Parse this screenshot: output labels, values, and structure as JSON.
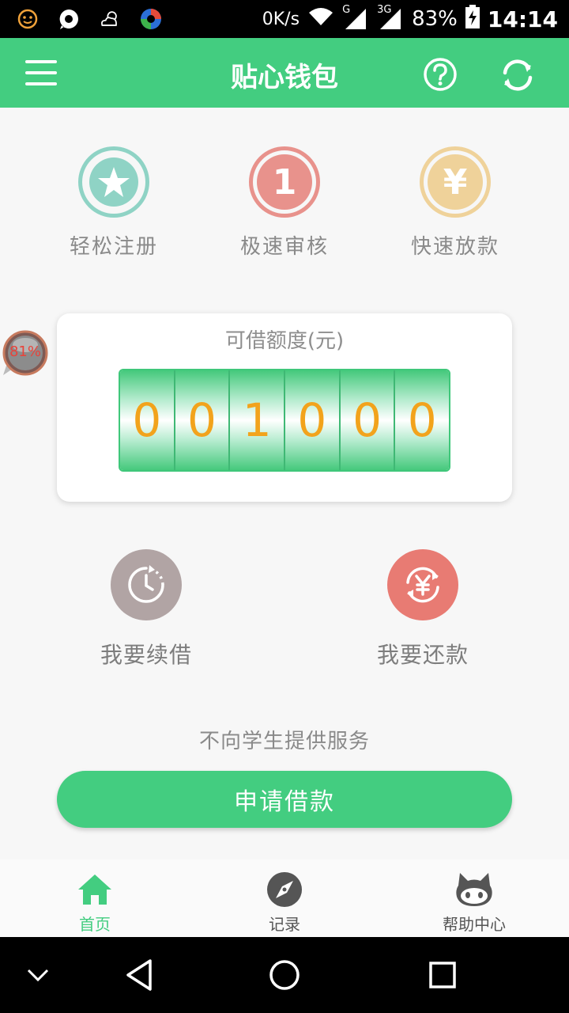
{
  "status_bar": {
    "net_speed": "0K/s",
    "battery": "83%",
    "time": "14:14",
    "network_g": "G",
    "network_3g": "3G"
  },
  "app_bar": {
    "title": "贴心钱包"
  },
  "features": [
    {
      "label": "轻松注册",
      "icon": "star-icon",
      "color": "#8fd3c5"
    },
    {
      "label": "极速审核",
      "icon": "one-icon",
      "color": "#e8928c",
      "glyph": "1"
    },
    {
      "label": "快速放款",
      "icon": "yuan-icon",
      "color": "#efd29a",
      "glyph": "¥"
    }
  ],
  "floating_badge": {
    "value": "81%"
  },
  "credit": {
    "title": "可借额度(元)",
    "digits": [
      "0",
      "0",
      "1",
      "0",
      "0",
      "0"
    ]
  },
  "actions": {
    "renew": {
      "label": "我要续借",
      "color": "#b1a4a4"
    },
    "repay": {
      "label": "我要还款",
      "color": "#e87b73"
    }
  },
  "notice": "不向学生提供服务",
  "apply_button": "申请借款",
  "bottom_nav": [
    {
      "label": "首页",
      "icon": "home-icon",
      "active": true
    },
    {
      "label": "记录",
      "icon": "compass-icon",
      "active": false
    },
    {
      "label": "帮助中心",
      "icon": "octocat-icon",
      "active": false
    }
  ],
  "colors": {
    "primary": "#43cd80",
    "digit_text": "#f2a31c"
  }
}
